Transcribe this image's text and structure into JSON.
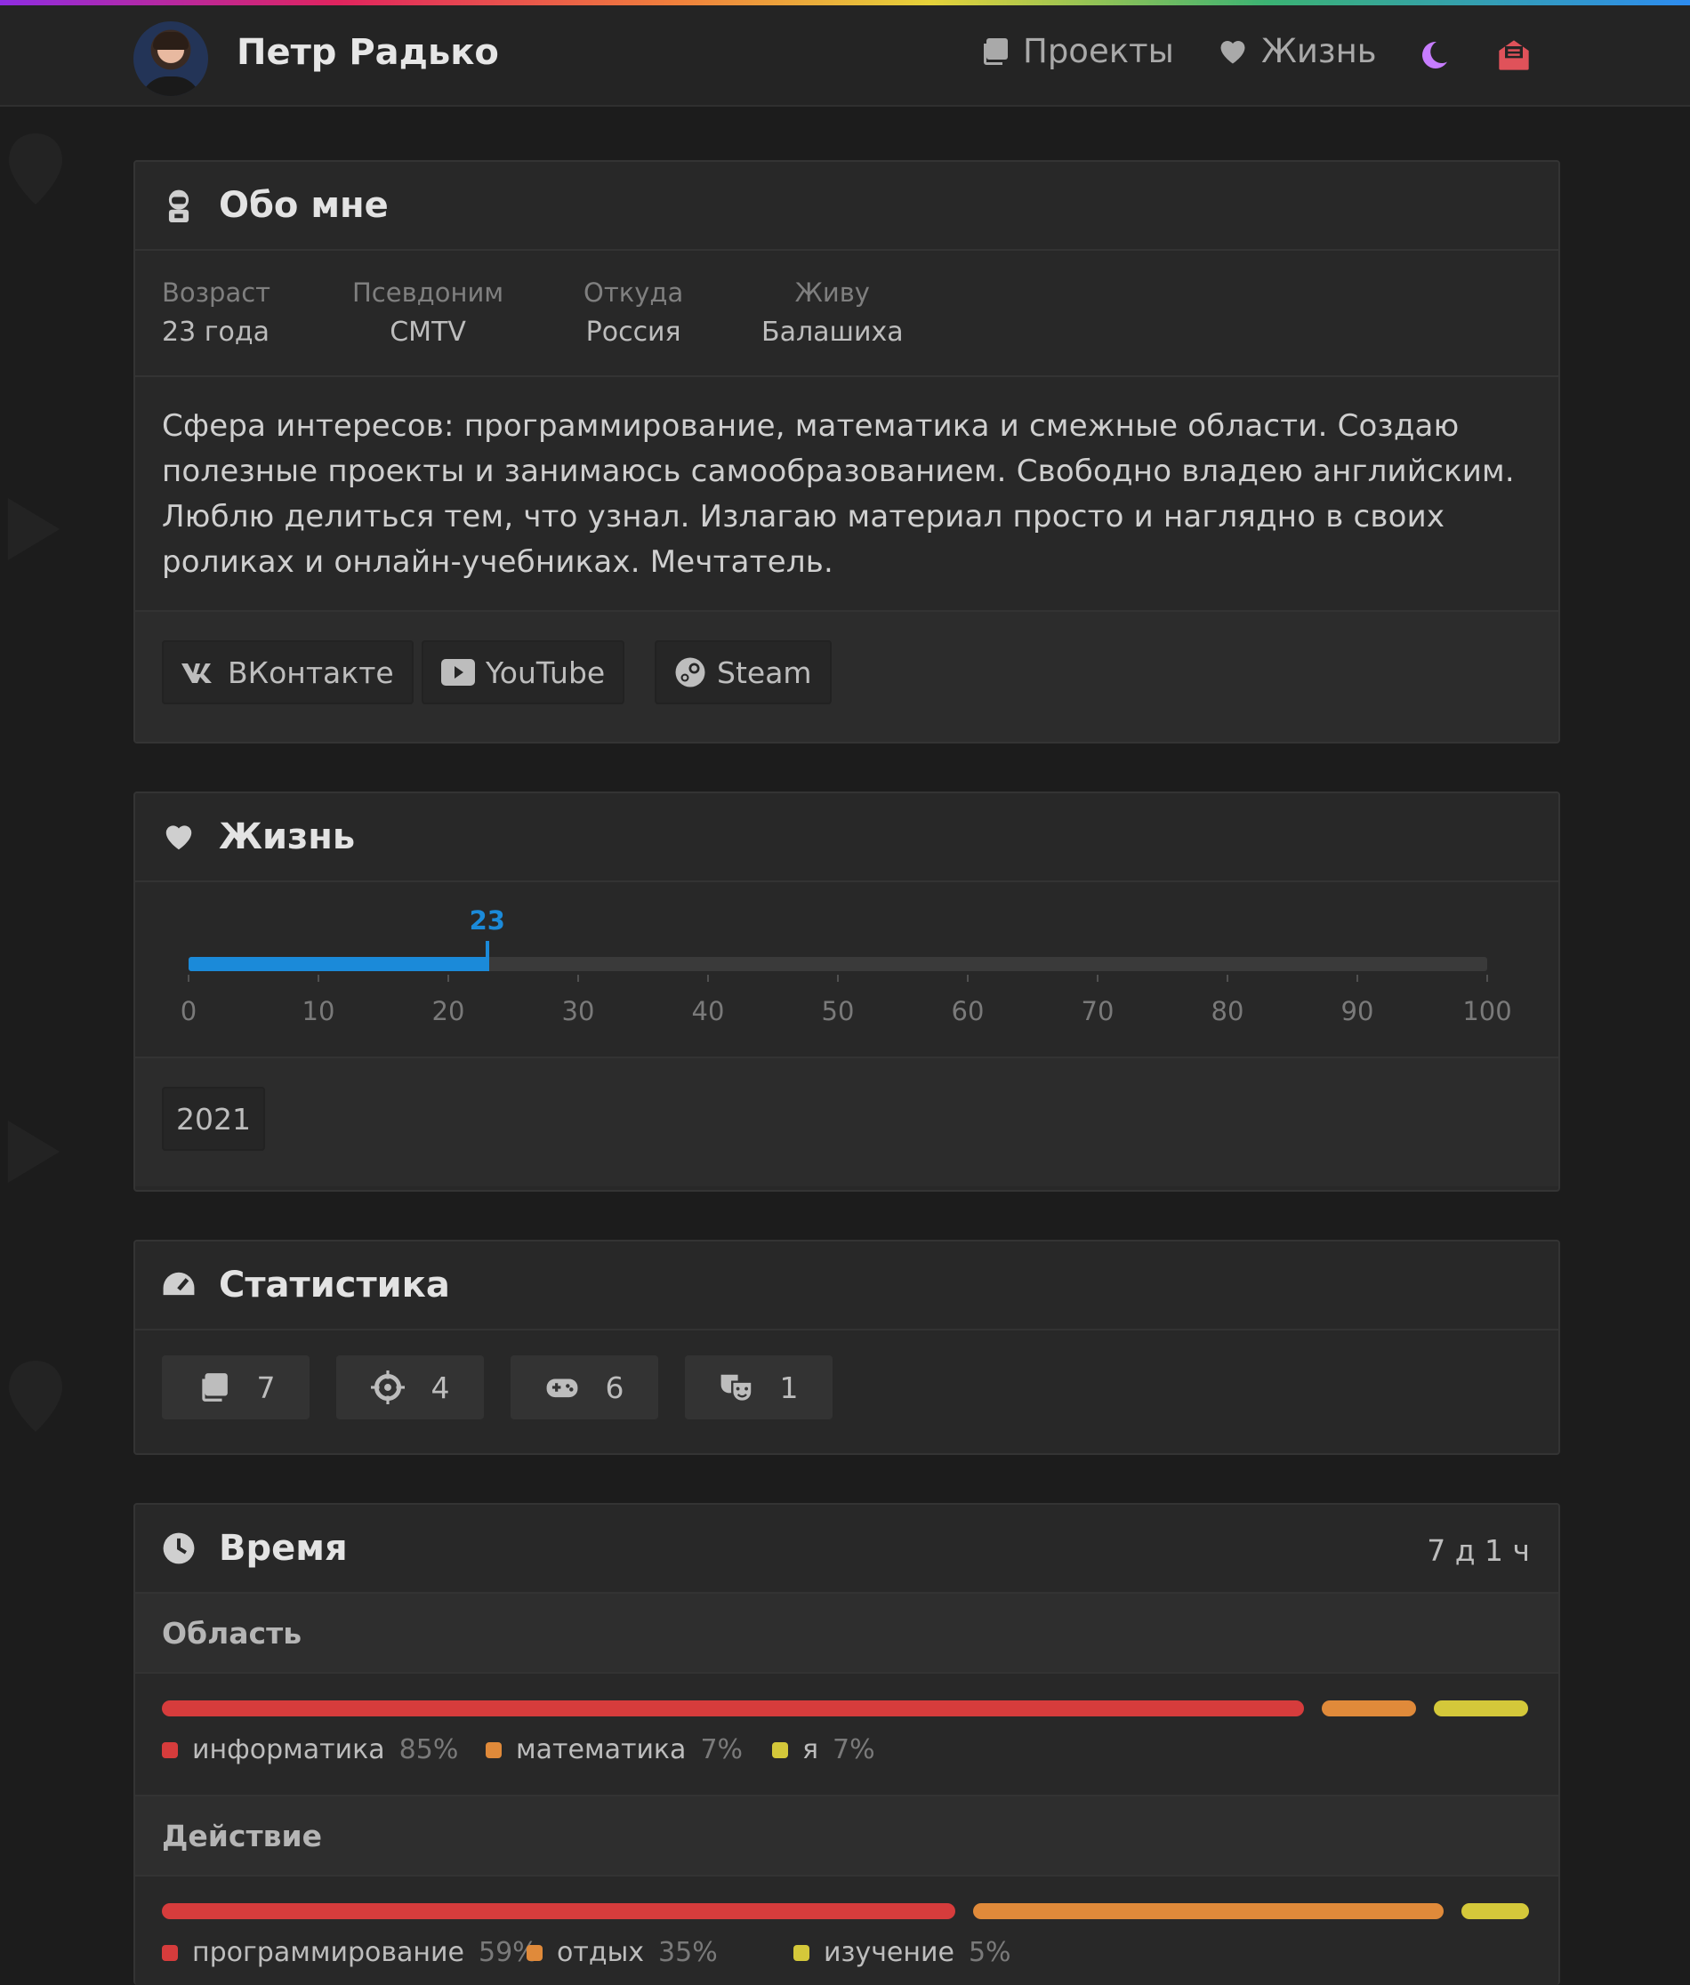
{
  "header": {
    "name": "Петр Радько",
    "nav": [
      {
        "label": "Проекты",
        "icon": "copy-icon"
      },
      {
        "label": "Жизнь",
        "icon": "heart-icon"
      }
    ],
    "theme_icon": "moon-icon",
    "mail_icon": "mail-icon"
  },
  "about": {
    "title": "Обо мне",
    "fields": [
      {
        "key": "Возраст",
        "value": "23 года"
      },
      {
        "key": "Псевдоним",
        "value": "CMTV"
      },
      {
        "key": "Откуда",
        "value": "Россия"
      },
      {
        "key": "Живу",
        "value": "Балашиха"
      }
    ],
    "bio": "Сфера интересов: программирование, математика и смежные области. Создаю полезные проекты и занимаюсь самообразованием. Свободно владею английским. Люблю делиться тем, что узнал. Излагаю материал просто и наглядно в своих роликах и онлайн-учебниках. Мечтатель.",
    "links": [
      {
        "label": "ВКонтакте",
        "icon": "vk-icon"
      },
      {
        "label": "YouTube",
        "icon": "youtube-icon"
      },
      {
        "label": "Steam",
        "icon": "steam-icon"
      }
    ]
  },
  "life": {
    "title": "Жизнь",
    "current": 23,
    "current_label": "23",
    "max": 100,
    "ticks": [
      "0",
      "10",
      "20",
      "30",
      "40",
      "50",
      "60",
      "70",
      "80",
      "90",
      "100"
    ],
    "year": "2021",
    "accent": "#1b8ad9"
  },
  "stats": {
    "title": "Статистика",
    "items": [
      {
        "icon": "copy-icon",
        "value": "7"
      },
      {
        "icon": "crosshair-icon",
        "value": "4"
      },
      {
        "icon": "gamepad-icon",
        "value": "6"
      },
      {
        "icon": "theater-masks-icon",
        "value": "1"
      }
    ]
  },
  "time": {
    "title": "Время",
    "total": "7 д 1 ч",
    "area": {
      "label": "Область",
      "items": [
        {
          "name": "информатика",
          "pct": "85%",
          "value": 85,
          "color": "#d63c3c"
        },
        {
          "name": "математика",
          "pct": "7%",
          "value": 7,
          "color": "#e08a3a"
        },
        {
          "name": "я",
          "pct": "7%",
          "value": 7,
          "color": "#d4c83a"
        }
      ]
    },
    "action": {
      "label": "Действие",
      "items": [
        {
          "name": "программирование",
          "pct": "59%",
          "value": 59,
          "color": "#d63c3c"
        },
        {
          "name": "отдых",
          "pct": "35%",
          "value": 35,
          "color": "#e08a3a"
        },
        {
          "name": "изучение",
          "pct": "5%",
          "value": 5,
          "color": "#d4c83a"
        }
      ]
    }
  }
}
